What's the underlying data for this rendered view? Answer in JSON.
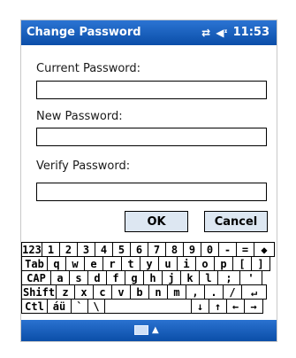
{
  "title_bar": {
    "title": "Change Password",
    "time": "11:53",
    "connectivity_icon": "connectivity-arrows-icon",
    "volume_icon": "speaker-icon"
  },
  "form": {
    "current_password_label": "Current Password:",
    "current_password_value": "",
    "new_password_label": "New Password:",
    "new_password_value": "",
    "verify_password_label": "Verify Password:",
    "verify_password_value": "",
    "ok_label": "OK",
    "cancel_label": "Cancel"
  },
  "keyboard": {
    "row1": [
      "123",
      "1",
      "2",
      "3",
      "4",
      "5",
      "6",
      "7",
      "8",
      "9",
      "0",
      "-",
      "=",
      "◆"
    ],
    "row2": [
      "Tab",
      "q",
      "w",
      "e",
      "r",
      "t",
      "y",
      "u",
      "i",
      "o",
      "p",
      "[",
      "]"
    ],
    "row3": [
      "CAP",
      "a",
      "s",
      "d",
      "f",
      "g",
      "h",
      "j",
      "k",
      "l",
      ";",
      "'"
    ],
    "row4": [
      "Shift",
      "z",
      "x",
      "c",
      "v",
      "b",
      "n",
      "m",
      ",",
      ".",
      "/",
      "↵"
    ],
    "row5": [
      "Ctl",
      "áü",
      "`",
      "\\",
      "",
      "↓",
      "↑",
      "←",
      "→"
    ]
  },
  "bottom_bar": {
    "sip_icon": "keyboard-icon",
    "sip_arrow": "▲"
  },
  "colors": {
    "title_bar": "#0b4ea8",
    "button_fill": "#dde7f2"
  }
}
